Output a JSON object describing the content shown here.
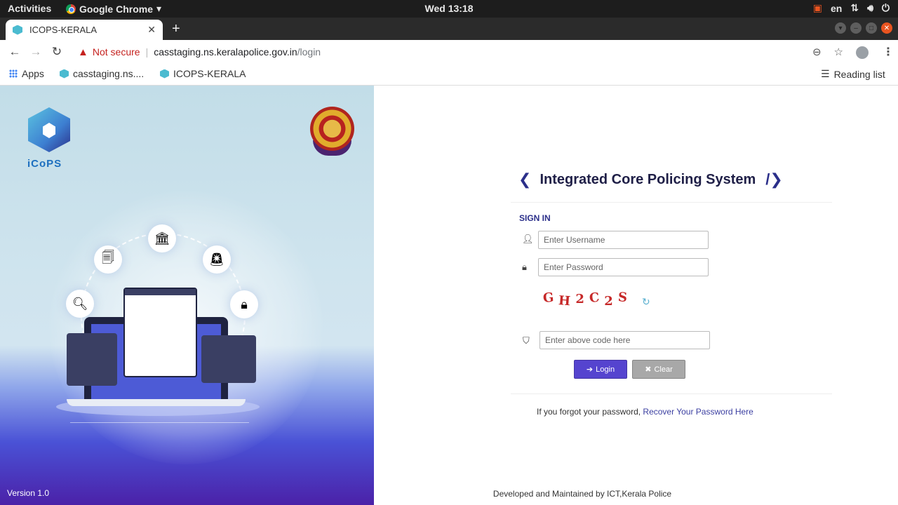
{
  "os": {
    "activities": "Activities",
    "app": "Google Chrome",
    "clock": "Wed 13:18",
    "lang": "en"
  },
  "browser": {
    "tab_title": "ICOPS-KERALA",
    "security": "Not secure",
    "host": "casstaging.ns.keralapolice.gov.in",
    "path": "/login",
    "bookmarks": [
      "Apps",
      "casstaging.ns....",
      "ICOPS-KERALA"
    ],
    "reading_list": "Reading list"
  },
  "left_panel": {
    "logo_text": "iCoPS",
    "version": "Version 1.0"
  },
  "login": {
    "title": "Integrated Core Policing System",
    "signin": "SIGN IN",
    "username_placeholder": "Enter Username",
    "password_placeholder": "Enter Password",
    "captcha": [
      "G",
      "H",
      "2",
      "C",
      "2",
      "S"
    ],
    "captcha_placeholder": "Enter above code here",
    "login_label": "Login",
    "clear_label": "Clear",
    "forgot_text": "If you forgot your password,",
    "recover_link": "Recover Your Password Here",
    "footer": "Developed and Maintained by ICT,Kerala Police"
  },
  "colors": {
    "primary": "#5544cf",
    "title": "#1f1f47",
    "captcha": "#c62828"
  }
}
